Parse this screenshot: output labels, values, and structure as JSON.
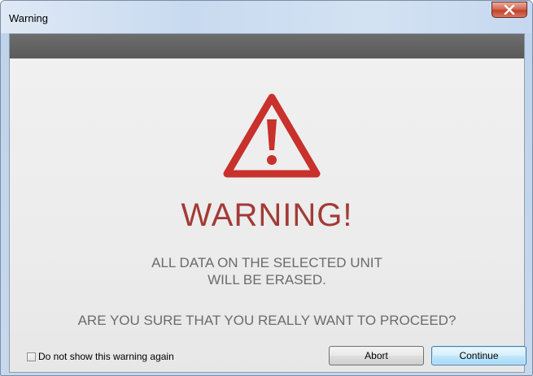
{
  "window": {
    "title": "Warning",
    "close_icon": "close-x-icon"
  },
  "dialog": {
    "icon": "warning-triangle-icon",
    "icon_color": "#c8312c",
    "heading": "WARNING!",
    "heading_color": "#a33a36",
    "message_line1": "ALL DATA ON THE SELECTED UNIT",
    "message_line2": "WILL BE ERASED.",
    "question": "ARE YOU SURE THAT YOU REALLY WANT TO PROCEED?"
  },
  "footer": {
    "checkbox_label": "Do not show this warning again",
    "checkbox_checked": false,
    "abort_label": "Abort",
    "continue_label": "Continue"
  }
}
